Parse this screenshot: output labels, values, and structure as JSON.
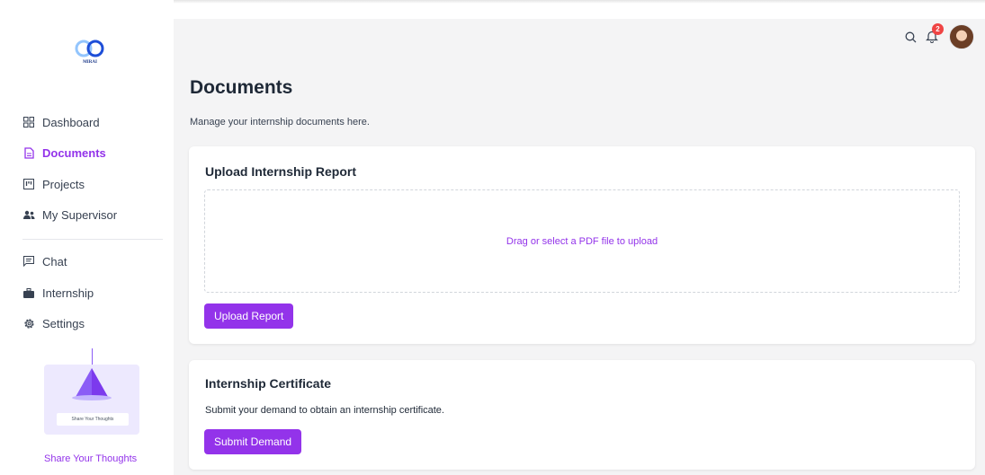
{
  "app": {
    "logo_text": "MIRAI"
  },
  "sidebar": {
    "items": [
      {
        "label": "Dashboard",
        "icon": "grid-icon"
      },
      {
        "label": "Documents",
        "icon": "document-icon"
      },
      {
        "label": "Projects",
        "icon": "kanban-icon"
      },
      {
        "label": "My Supervisor",
        "icon": "users-icon"
      },
      {
        "label": "Chat",
        "icon": "chat-icon"
      },
      {
        "label": "Internship",
        "icon": "briefcase-icon"
      },
      {
        "label": "Settings",
        "icon": "gear-icon"
      }
    ],
    "active_item": "Documents",
    "promo": {
      "button_label": "Share Your Thoughts",
      "link_label": "Share Your Thoughts"
    }
  },
  "topbar": {
    "notification_count": "2"
  },
  "page": {
    "title": "Documents",
    "subtitle": "Manage your internship documents here."
  },
  "upload_card": {
    "title": "Upload Internship Report",
    "dropzone_text": "Drag or select a PDF file to upload",
    "button_label": "Upload Report"
  },
  "certificate_card": {
    "title": "Internship Certificate",
    "description": "Submit your demand to obtain an internship certificate.",
    "button_label": "Submit Demand"
  },
  "colors": {
    "accent": "#9333ea",
    "badge": "#ef4444",
    "background": "#f4f4f5"
  }
}
